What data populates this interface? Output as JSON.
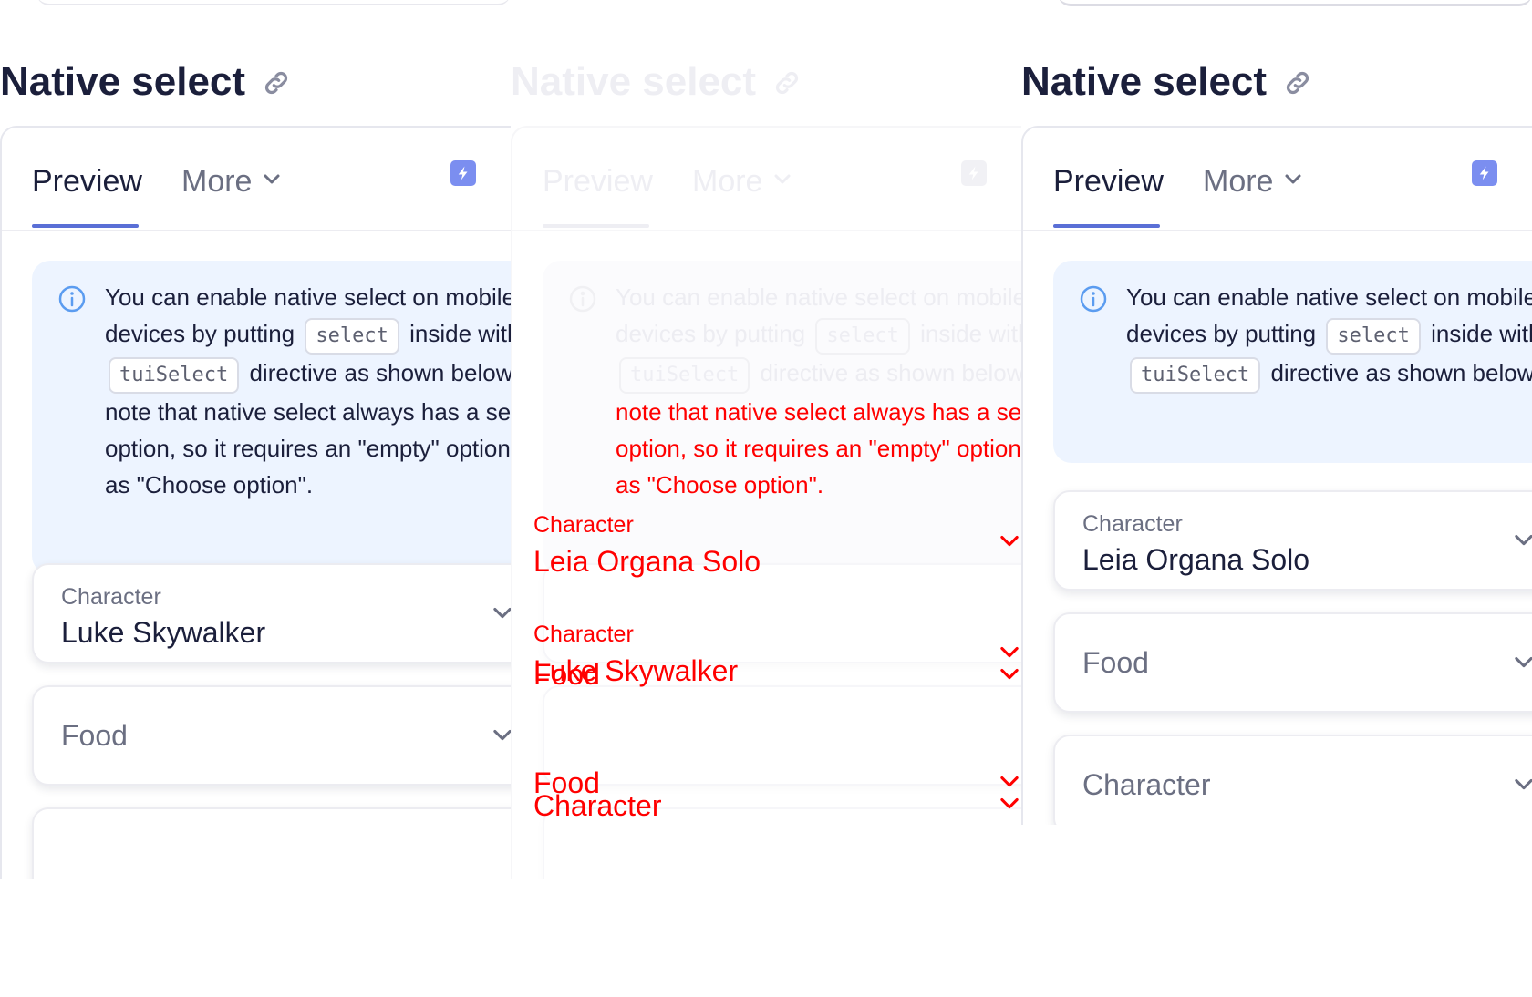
{
  "panels": [
    {
      "title": "Native select",
      "tabs": {
        "preview": "Preview",
        "more": "More"
      },
      "notice": {
        "line1": "You can enable native select on mobile devices by putting",
        "code1": "select",
        "line2a": "inside with",
        "code2": "tuiSelect",
        "line2b": "directive as shown below. Please note that native select always has a selected option, so it requires an \"empty\" option, such as \"Choose option\"."
      },
      "fields": [
        {
          "label": "Character",
          "value": "Luke Skywalker"
        },
        {
          "placeholder": "Food"
        }
      ]
    },
    {
      "title": "Native select",
      "tabs": {
        "preview": "Preview",
        "more": "More"
      },
      "notice": {
        "line1": "You can enable native select on mobile devices by putting",
        "code1": "select",
        "line2a": "inside with",
        "code2": "tuiSelect",
        "line2b_faded": "directive as shown below",
        "line2b_diff": ". Please note that native select always has a selected option, so it requires an \"empty\" option, such as \"Choose option\"."
      },
      "overlays": {
        "character_label_a": "Character",
        "character_value_a": "Leia Organa Solo",
        "character_label_b": "Character",
        "character_value_b": "Luke Skywalker",
        "food_a": "Food",
        "food_b": "Food",
        "character_c": "Character"
      }
    },
    {
      "title": "Native select",
      "tabs": {
        "preview": "Preview",
        "more": "More"
      },
      "notice": {
        "line1": "You can enable native select on mobile devices by putting",
        "code1": "select",
        "line2a": "inside with",
        "code2": "tuiSelect",
        "line2b": "directive as shown below"
      },
      "fields": [
        {
          "label": "Character",
          "value": "Leia Organa Solo"
        },
        {
          "placeholder": "Food"
        },
        {
          "placeholder": "Character"
        }
      ]
    }
  ],
  "colors": {
    "accent": "#5a6fd6",
    "bolt": "#7b8ef0",
    "notice_bg": "#edf4ff",
    "info_icon": "#5b9cf0",
    "diff_red": "#ff0000",
    "text": "#1b1f3b",
    "muted": "#6b6f82"
  },
  "icons": [
    "link-icon",
    "chevron-down-icon",
    "bolt-icon",
    "info-icon"
  ]
}
